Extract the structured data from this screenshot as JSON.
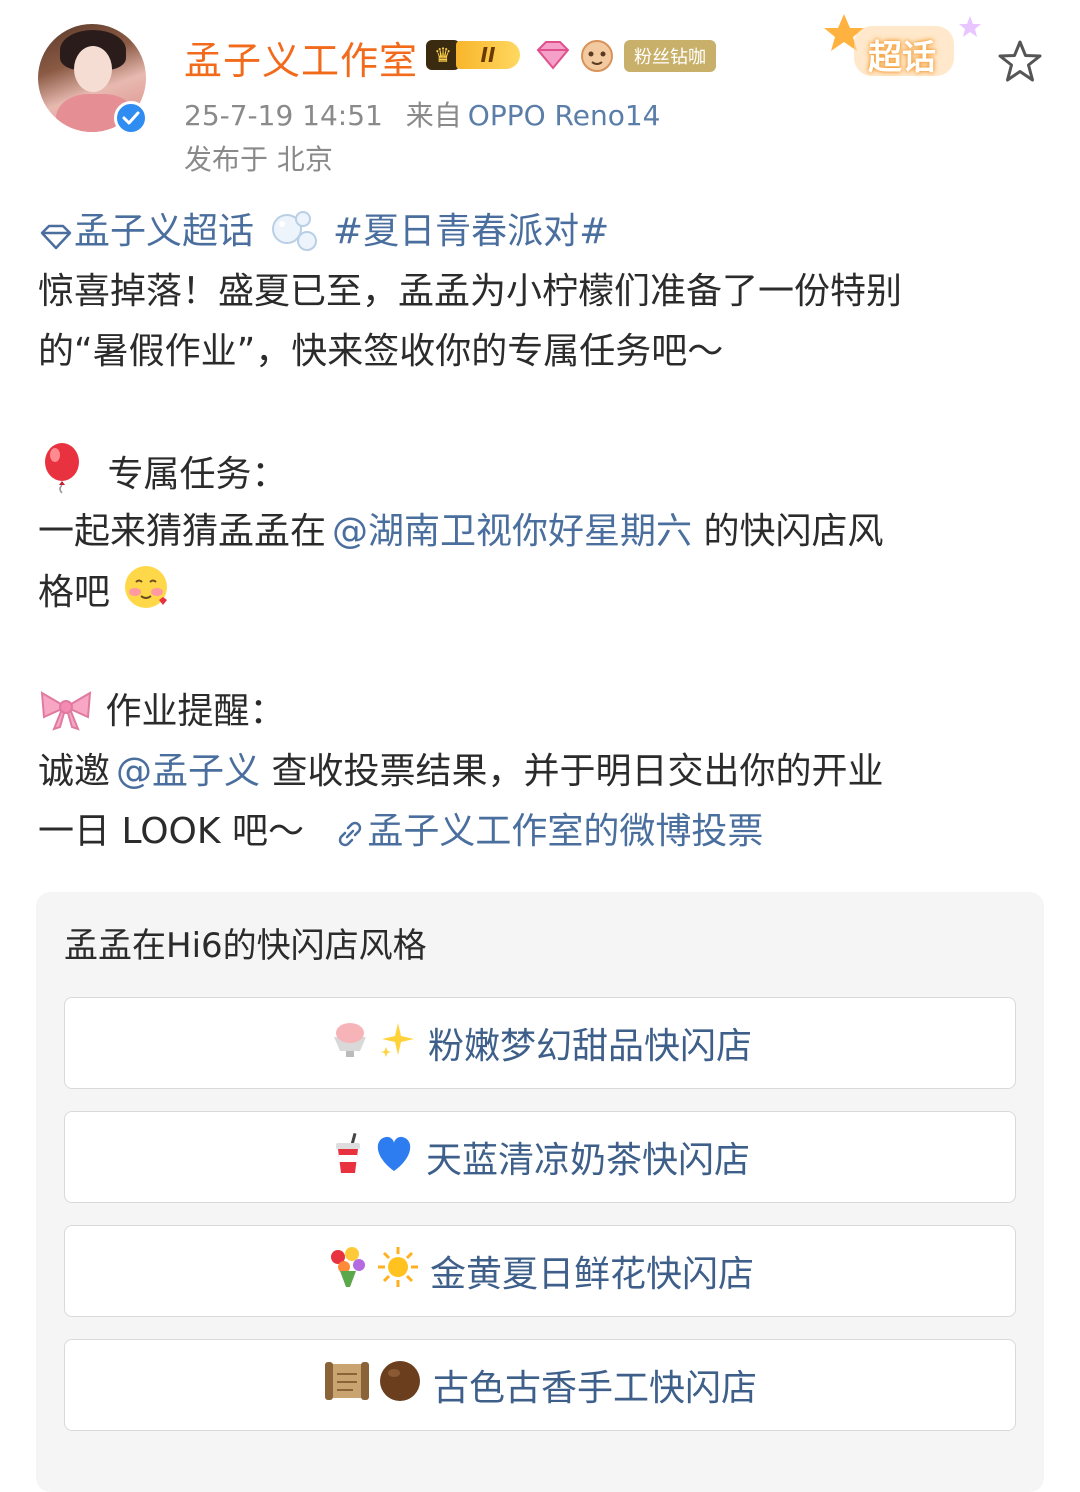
{
  "header": {
    "username": "孟子义工作室",
    "level_label": "II",
    "fan_badge": "粉丝钻咖",
    "timestamp": "25-7-19 14:51",
    "source_prefix": "来自",
    "source_device": "OPPO Reno14",
    "location": "发布于 北京",
    "supertopic_label": "超话"
  },
  "post": {
    "topic_link": "孟子义超话",
    "hashtag": "#夏日青春派对#",
    "line1": "惊喜掉落！盛夏已至，孟孟为小柠檬们准备了一份特别",
    "line2": "的“暑假作业”，快来签收你的专属任务吧～",
    "task_title": "专属任务：",
    "task_line1_prefix": "一起来猜猜孟孟在",
    "task_mention": "@湖南卫视你好星期六",
    "task_line1_suffix": " 的快闪店风",
    "task_line2": "格吧",
    "reminder_title": "作业提醒：",
    "reminder_prefix": "诚邀",
    "reminder_mention": "@孟子义",
    "reminder_suffix": " 查收投票结果，并于明日交出你的开业",
    "reminder_line2": "一日 LOOK 吧～",
    "vote_link": "孟子义工作室的微博投票"
  },
  "poll": {
    "title": "孟孟在Hi6的快闪店风格",
    "options": [
      {
        "icons": [
          "🍧",
          "✨"
        ],
        "label": "粉嫩梦幻甜品快闪店"
      },
      {
        "icons": [
          "🥤",
          "💙"
        ],
        "label": "天蓝清凉奶茶快闪店"
      },
      {
        "icons": [
          "💐",
          "☀️"
        ],
        "label": "金黄夏日鲜花快闪店"
      },
      {
        "icons": [
          "📜",
          "🟤"
        ],
        "label": "古色古香手工快闪店"
      }
    ]
  },
  "colors": {
    "username": "#f26b1d",
    "link": "#4a6f9e",
    "meta": "#8a8a8a",
    "verified": "#2f8cf0"
  }
}
